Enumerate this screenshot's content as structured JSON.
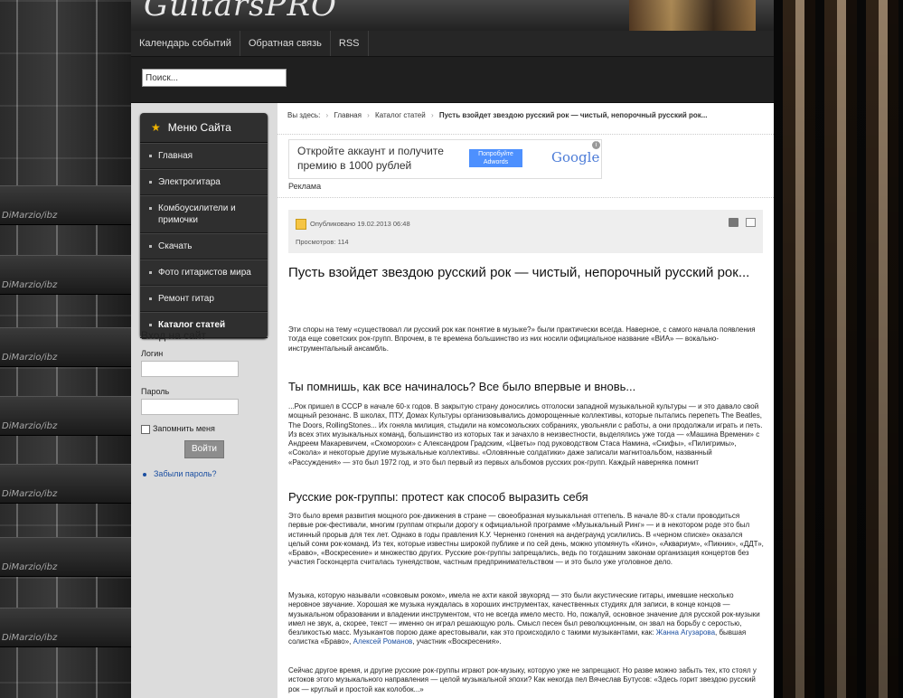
{
  "site": {
    "logo": "GuitarsPRO"
  },
  "topnav": [
    "Календарь событий",
    "Обратная связь",
    "RSS"
  ],
  "search": {
    "placeholder": "Поиск..."
  },
  "sidebar": {
    "menu_title": "Меню Сайта",
    "items": [
      "Главная",
      "Электрогитара",
      "Комбоусилители и примочки",
      "Скачать",
      "Фото гитаристов мира",
      "Ремонт гитар",
      "Каталог статей"
    ],
    "login_title": "Вход на сайт",
    "login_label": "Логин",
    "password_label": "Пароль",
    "remember_label": "Запомнить меня",
    "login_button": "Войти",
    "forgot_link": "Забыли пароль?"
  },
  "breadcrumb": {
    "prefix": "Вы здесь:",
    "items": [
      "Главная",
      "Каталог статей"
    ],
    "current": "Пусть взойдет звездою русский рок — чистый, непорочный русский рок..."
  },
  "ad": {
    "text_line1": "Откройте аккаунт и получите",
    "text_line2": "премию в 1000 рублей",
    "button_line1": "Попробуйте",
    "button_line2": "Adwords",
    "logo": "Google",
    "label": "Реклама"
  },
  "article": {
    "published": "Опубликовано 19.02.2013 06:48",
    "views": "Просмотров: 114",
    "title": "Пусть взойдет звездою русский рок — чистый, непорочный русский рок...",
    "intro": "Эти споры на тему «существовал ли русский рок как понятие в музыке?» были практически всегда. Наверное, с самого начала появления тогда еще советских рок-групп. Впрочем, в те времена большинство из них носили официальное название «ВИА» — вокально-инструментальный ансамбль.",
    "h2_1": "Ты помнишь, как все начиналось? Все было впервые и вновь...",
    "p1": "...Рок пришел в СССР в начале 60-х годов. В закрытую страну доносились отголоски западной музыкальной культуры — и это давало свой мощный резонанс. В школах, ПТУ, Домах Культуры организовывались доморощенные коллективы, которые пытались перепеть The Beatles, The Doors, RollingStones... Их гоняла милиция, стыдили на комсомольских собраниях, увольняли с работы, а они продолжали играть и петь. Из всех этих музыкальных команд, большинство из которых так и зачахло в неизвестности, выделялись уже тогда — «Машина Времени» с Андреем Макаревичем, «Скоморохи» с Александром Градским, «Цветы» под руководством Стаса Намина, «Скифы», «Пилигримы», «Сокола» и некоторые другие музыкальные коллективы. «Оловянные солдатики» даже записали магнитоальбом, названный «Рассуждения» — это был 1972 год, и это был первый из первых альбомов русских рок-групп. Каждый наверняка помнит",
    "h2_2": "Русские рок-группы: протест как способ выразить себя",
    "p2": "Это было время развития мощного рок-движения в стране — своеобразная музыкальная оттепель. В начале 80-х стали проводиться первые рок-фестивали, многим группам открыли дорогу к официальной программе «Музыкальный Ринг» — и в некотором роде это был истинный прорыв для тех лет. Однако в годы правления К.У. Черненко гонения на андеграунд усилились. В «черном списке» оказался целый сонм рок-команд. Из тех, которые известны широкой публике и по сей день, можно упомянуть «Кино», «Аквариум», «Пикник», «ДДТ», «Браво», «Воскресение» и множество других. Русские рок-группы запрещались, ведь по тогдашним законам организация концертов без участия Госконцерта считалась тунеядством, частным предпринимательством — и это было уже уголовное дело.",
    "p3_text": "Музыка, которую называли «совковым роком», имела не ахти какой звукоряд — это были акустические гитары, имевшие несколько неровное звучание. Хорошая же музыка нуждалась в хороших инструментах, качественных студиях для записи, в конце концов — музыкальном образовании и владении инструментом, что не всегда имело место. Но, пожалуй, основное значение для русской рок-музыки имел не звук, а, скорее, текст — именно он играл решающую роль. Смысл песен был революционным, он звал на борьбу с серостью, безликостью масс. Музыкантов порою даже арестовывали, как это происходило с такими музыкантами, как:",
    "p3_link1": "Жанна Агузарова",
    "p3_mid": ", бывшая солистка «Браво»,",
    "p3_link2": "Алексей Романов",
    "p3_end": ", участник «Воскресения».",
    "p4": "Сейчас другое время, и другие русские рок-группы играют рок-музыку, которую уже не запрещают. Но разве можно забыть тех, кто стоял у истоков этого музыкального направления — целой музыкальной эпохи? Как некогда пел Вячеслав Бутусов: «Здесь горит звездою русский рок — круглый и простой как колобок...»"
  },
  "background": {
    "left_brand": "DiMarzio/ibz"
  }
}
